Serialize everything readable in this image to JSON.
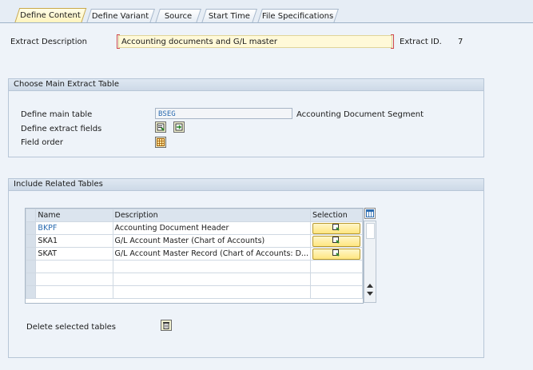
{
  "tabs": [
    {
      "label": "Define Content",
      "active": true
    },
    {
      "label": "Define Variant",
      "active": false
    },
    {
      "label": "Source",
      "active": false
    },
    {
      "label": "Start Time",
      "active": false
    },
    {
      "label": "File Specifications",
      "active": false
    }
  ],
  "header": {
    "extract_description_label": "Extract Description",
    "extract_description_value": "Accounting documents and G/L master",
    "extract_id_label": "Extract ID.",
    "extract_id_value": "7"
  },
  "main_table_panel": {
    "title": "Choose Main Extract Table",
    "define_main_table_label": "Define main table",
    "main_table_value": "BSEG",
    "main_table_description": "Accounting Document Segment",
    "define_extract_fields_label": "Define extract fields",
    "field_order_label": "Field order"
  },
  "related_panel": {
    "title": "Include Related Tables",
    "columns": [
      "Name",
      "Description",
      "Selection"
    ],
    "rows": [
      {
        "name": "BKPF",
        "description": "Accounting Document Header",
        "link": true
      },
      {
        "name": "SKA1",
        "description": "G/L Account Master (Chart of Accounts)",
        "link": false
      },
      {
        "name": "SKAT",
        "description": "G/L Account Master Record (Chart of Accounts: D...",
        "link": false
      }
    ],
    "delete_label": "Delete selected tables"
  },
  "colors": {
    "accent": "#2a6bb0",
    "input_highlight": "#fff9d8",
    "panel_header": "#cdd9e7"
  }
}
